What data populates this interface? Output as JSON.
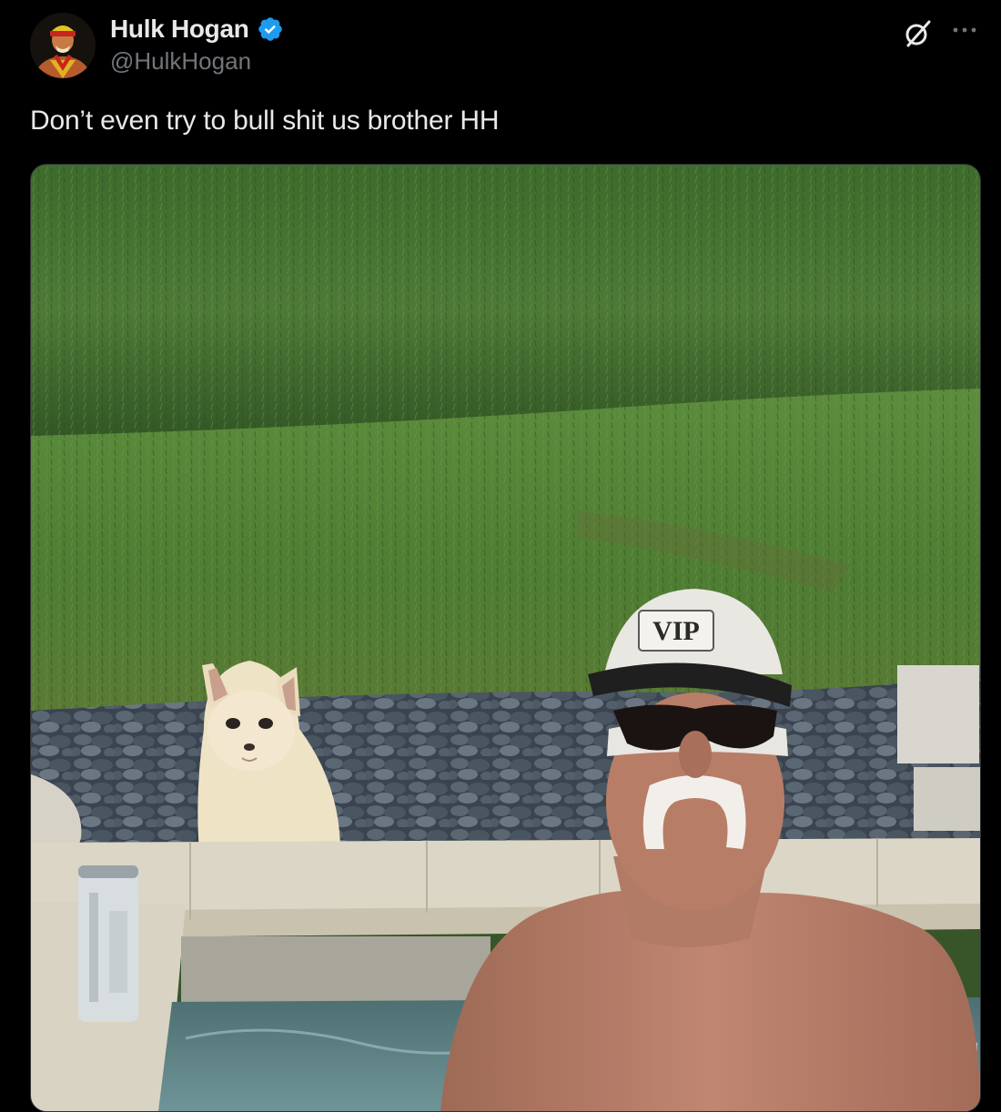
{
  "post": {
    "author": {
      "display_name": "Hulk Hogan",
      "handle": "@HulkHogan",
      "verified": true
    },
    "text": "Don’t even try to bull shit us brother HH",
    "media": {
      "cap_text": "VIP"
    }
  },
  "icons": {
    "verified": "verified-badge-icon",
    "grok": "grok-icon",
    "more": "more-options-icon"
  },
  "colors": {
    "background": "#000000",
    "text_primary": "#e7e9ea",
    "text_secondary": "#71767b",
    "verified": "#1d9bf0"
  }
}
